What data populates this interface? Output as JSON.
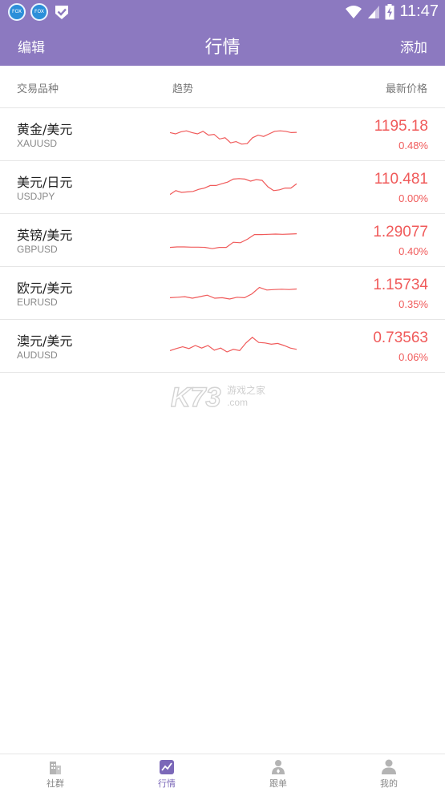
{
  "status_bar": {
    "time": "11:47"
  },
  "header": {
    "edit_label": "编辑",
    "title": "行情",
    "add_label": "添加"
  },
  "columns": {
    "name": "交易品种",
    "trend": "趋势",
    "price": "最新价格"
  },
  "colors": {
    "accent": "#8c79c0",
    "up": "#f05a5a",
    "nav_active": "#7b68b8"
  },
  "quotes": [
    {
      "name": "黄金/美元",
      "code": "XAUUSD",
      "price": "1195.18",
      "change": "0.48%",
      "trend": [
        0.55,
        0.5,
        0.58,
        0.62,
        0.55,
        0.5,
        0.6,
        0.45,
        0.48,
        0.3,
        0.35,
        0.15,
        0.2,
        0.1,
        0.12,
        0.35,
        0.45,
        0.4,
        0.5,
        0.6,
        0.62,
        0.6,
        0.55,
        0.56
      ]
    },
    {
      "name": "美元/日元",
      "code": "USDJPY",
      "price": "110.481",
      "change": "0.00%",
      "trend": [
        0.2,
        0.35,
        0.28,
        0.3,
        0.32,
        0.4,
        0.45,
        0.55,
        0.55,
        0.62,
        0.68,
        0.8,
        0.82,
        0.8,
        0.72,
        0.78,
        0.75,
        0.5,
        0.35,
        0.38,
        0.45,
        0.45,
        0.62
      ]
    },
    {
      "name": "英镑/美元",
      "code": "GBPUSD",
      "price": "1.29077",
      "change": "0.40%",
      "trend": [
        0.2,
        0.22,
        0.22,
        0.21,
        0.21,
        0.2,
        0.15,
        0.2,
        0.2,
        0.4,
        0.38,
        0.52,
        0.7,
        0.7,
        0.71,
        0.72,
        0.71,
        0.72,
        0.73
      ]
    },
    {
      "name": "欧元/美元",
      "code": "EURUSD",
      "price": "1.15734",
      "change": "0.35%",
      "trend": [
        0.3,
        0.32,
        0.34,
        0.28,
        0.34,
        0.4,
        0.28,
        0.3,
        0.25,
        0.32,
        0.3,
        0.45,
        0.7,
        0.6,
        0.62,
        0.63,
        0.62,
        0.64
      ]
    },
    {
      "name": "澳元/美元",
      "code": "AUDUSD",
      "price": "0.73563",
      "change": "0.06%",
      "trend": [
        0.3,
        0.38,
        0.45,
        0.38,
        0.5,
        0.4,
        0.5,
        0.32,
        0.4,
        0.25,
        0.35,
        0.3,
        0.6,
        0.82,
        0.62,
        0.6,
        0.55,
        0.58,
        0.5,
        0.4,
        0.35
      ]
    }
  ],
  "watermark": {
    "brand": "K73",
    "subtitle": "游戏之家",
    "domain": ".com"
  },
  "nav": [
    {
      "label": "社群",
      "icon": "building-icon"
    },
    {
      "label": "行情",
      "icon": "chart-icon",
      "active": true
    },
    {
      "label": "跟单",
      "icon": "follow-icon"
    },
    {
      "label": "我的",
      "icon": "user-icon"
    }
  ]
}
